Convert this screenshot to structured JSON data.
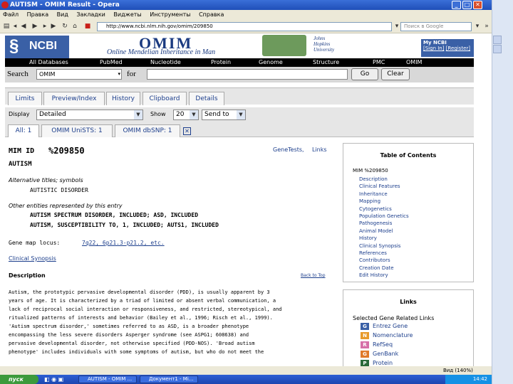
{
  "window": {
    "title": "AUTISM - OMIM Result - Opera"
  },
  "menu": [
    "Файл",
    "Правка",
    "Вид",
    "Закладки",
    "Виджеты",
    "Инструменты",
    "Справка"
  ],
  "address": {
    "url": "http://www.ncbi.nlm.nih.gov/omim/209850",
    "search_placeholder": "Поиск в Google"
  },
  "banner": {
    "ncbi": "NCBI",
    "omim": "OMIM",
    "omim_sub": "Online Mendelian Inheritance in Man",
    "jhu": [
      "Johns",
      "Hopkins",
      "University"
    ],
    "my_ncbi": "My NCBI",
    "sign_in": "[Sign In]",
    "register": "[Register]"
  },
  "nav": [
    "All Databases",
    "PubMed",
    "Nucleotide",
    "Protein",
    "Genome",
    "Structure",
    "PMC",
    "OMIM"
  ],
  "search": {
    "label": "Search",
    "db": "OMIM",
    "for": "for",
    "go": "Go",
    "clear": "Clear"
  },
  "tabs": [
    "Limits",
    "Preview/Index",
    "History",
    "Clipboard",
    "Details"
  ],
  "display": {
    "label": "Display",
    "value": "Detailed",
    "show": "Show",
    "count": "20",
    "send_to": "Send to"
  },
  "subtabs": [
    "All: 1",
    "OMIM UniSTS: 1",
    "OMIM dbSNP: 1"
  ],
  "entry": {
    "mim_label": "MIM ID",
    "mim_id": "%209850",
    "title": "AUTISM",
    "genetests": "GeneTests,",
    "links": "Links",
    "alt_head": "Alternative titles; symbols",
    "alt_value": "AUTISTIC DISORDER",
    "other_head": "Other entities represented by this entry",
    "other1": "AUTISM SPECTRUM DISORDER, INCLUDED; ASD, INCLUDED",
    "other2": "AUTISM, SUSCEPTIBILITY TO, 1, INCLUDED; AUTS1, INCLUDED",
    "gene_map_label": "Gene map locus:",
    "gene_map_value": "7q22, 6p21.3-p21.2, etc.",
    "clinical_synopsis": "Clinical Synopsis",
    "desc_head": "Description",
    "back_to_top": "Back to Top",
    "desc_lines": [
      "Autism, the prototypic pervasive developmental disorder (PDD), is usually apparent by 3",
      "years of age. It is characterized by a triad of limited or absent verbal communication, a",
      "lack of reciprocal social interaction or responsiveness, and restricted, stereotypical, and",
      "ritualized patterns of interests and behavior (Bailey et al., 1996; Risch et al., 1999).",
      "'Autism spectrum disorder,' sometimes referred to as ASD, is a broader phenotype",
      "encompassing the less severe disorders Asperger syndrome (see ASPG1; 608638) and",
      "pervasive developmental disorder, not otherwise specified (PDD-NOS). 'Broad autism",
      "phenotype' includes individuals with some symptoms of autism, but who do not meet the"
    ]
  },
  "toc": {
    "title": "Table of Contents",
    "mim": "MIM %209850",
    "items": [
      "Description",
      "Clinical Features",
      "Inheritance",
      "Mapping",
      "Cytogenetics",
      "Population Genetics",
      "Pathogenesis",
      "Animal Model",
      "History",
      "Clinical Synopsis",
      "References",
      "Contributors",
      "Creation Date",
      "Edit History"
    ]
  },
  "links_box": {
    "title": "Links",
    "subtitle": "Selected Gene Related Links",
    "items": [
      {
        "tag": "G",
        "label": "Entrez Gene",
        "color": "#3a60a6"
      },
      {
        "tag": "N",
        "label": "Nomenclature",
        "color": "#e89a2a"
      },
      {
        "tag": "R",
        "label": "RefSeq",
        "color": "#d66fa8"
      },
      {
        "tag": "G",
        "label": "GenBank",
        "color": "#e07a2a"
      },
      {
        "tag": "P",
        "label": "Protein",
        "color": "#2a6a3a"
      }
    ]
  },
  "status": {
    "zoom": "Вид (140%)"
  },
  "taskbar": {
    "start": "пуск",
    "tasks": [
      "AUTISM - OMIM ...",
      "Документ1 - Mi..."
    ],
    "clock": "14:42"
  }
}
